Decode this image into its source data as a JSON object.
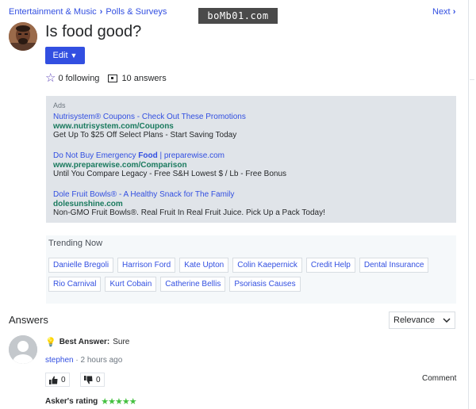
{
  "breadcrumb": {
    "items": [
      "Entertainment & Music",
      "Polls & Surveys"
    ],
    "separator": "›"
  },
  "watermark": "boMb01.com",
  "next_label": "Next",
  "next_icon": "chevron-right-icon",
  "question": {
    "title": "Is food good?"
  },
  "edit_label": "Edit",
  "stats": {
    "following": "0 following",
    "answers": "10 answers"
  },
  "ads": {
    "label": "Ads",
    "items": [
      {
        "title_pre": "Nutrisystem® Coupons - Check Out These Promotions",
        "title_bold": "",
        "title_post": "",
        "url": "www.nutrisystem.com/Coupons",
        "desc": "Get Up To $25 Off Select Plans - Start Saving Today"
      },
      {
        "title_pre": "Do Not Buy Emergency ",
        "title_bold": "Food",
        "title_post": " | preparewise.com",
        "url": "www.preparewise.com/Comparison",
        "desc": "Until You Compare Legacy - Free S&H Lowest $ / Lb - Free Bonus"
      },
      {
        "title_pre": "Dole Fruit Bowls® - A Healthy Snack for The Family",
        "title_bold": "",
        "title_post": "",
        "url": "dolesunshine.com",
        "desc": "Non-GMO Fruit Bowls®. Real Fruit In Real Fruit Juice. Pick Up a Pack Today!"
      }
    ]
  },
  "trending": {
    "heading": "Trending Now",
    "chips": [
      "Danielle Bregoli",
      "Harrison Ford",
      "Kate Upton",
      "Colin Kaepernick",
      "Credit Help",
      "Dental Insurance",
      "Rio Carnival",
      "Kurt Cobain",
      "Catherine Bellis",
      "Psoriasis Causes"
    ]
  },
  "answers": {
    "heading": "Answers",
    "sort": "Relevance",
    "best_label": "Best Answer:",
    "best_text": "Sure",
    "user": "stephen",
    "time": "· 2 hours ago",
    "thumbs_up": "0",
    "thumbs_down": "0",
    "comment": "Comment",
    "asker_rating_label": "Asker's rating",
    "asker_rating": 5,
    "asker_rating_stars": "★★★★★"
  },
  "colors": {
    "accent": "#324fe1",
    "ad_url": "#1a7a5e",
    "ad_bg": "#e0e4e9",
    "rating": "#44c040"
  }
}
